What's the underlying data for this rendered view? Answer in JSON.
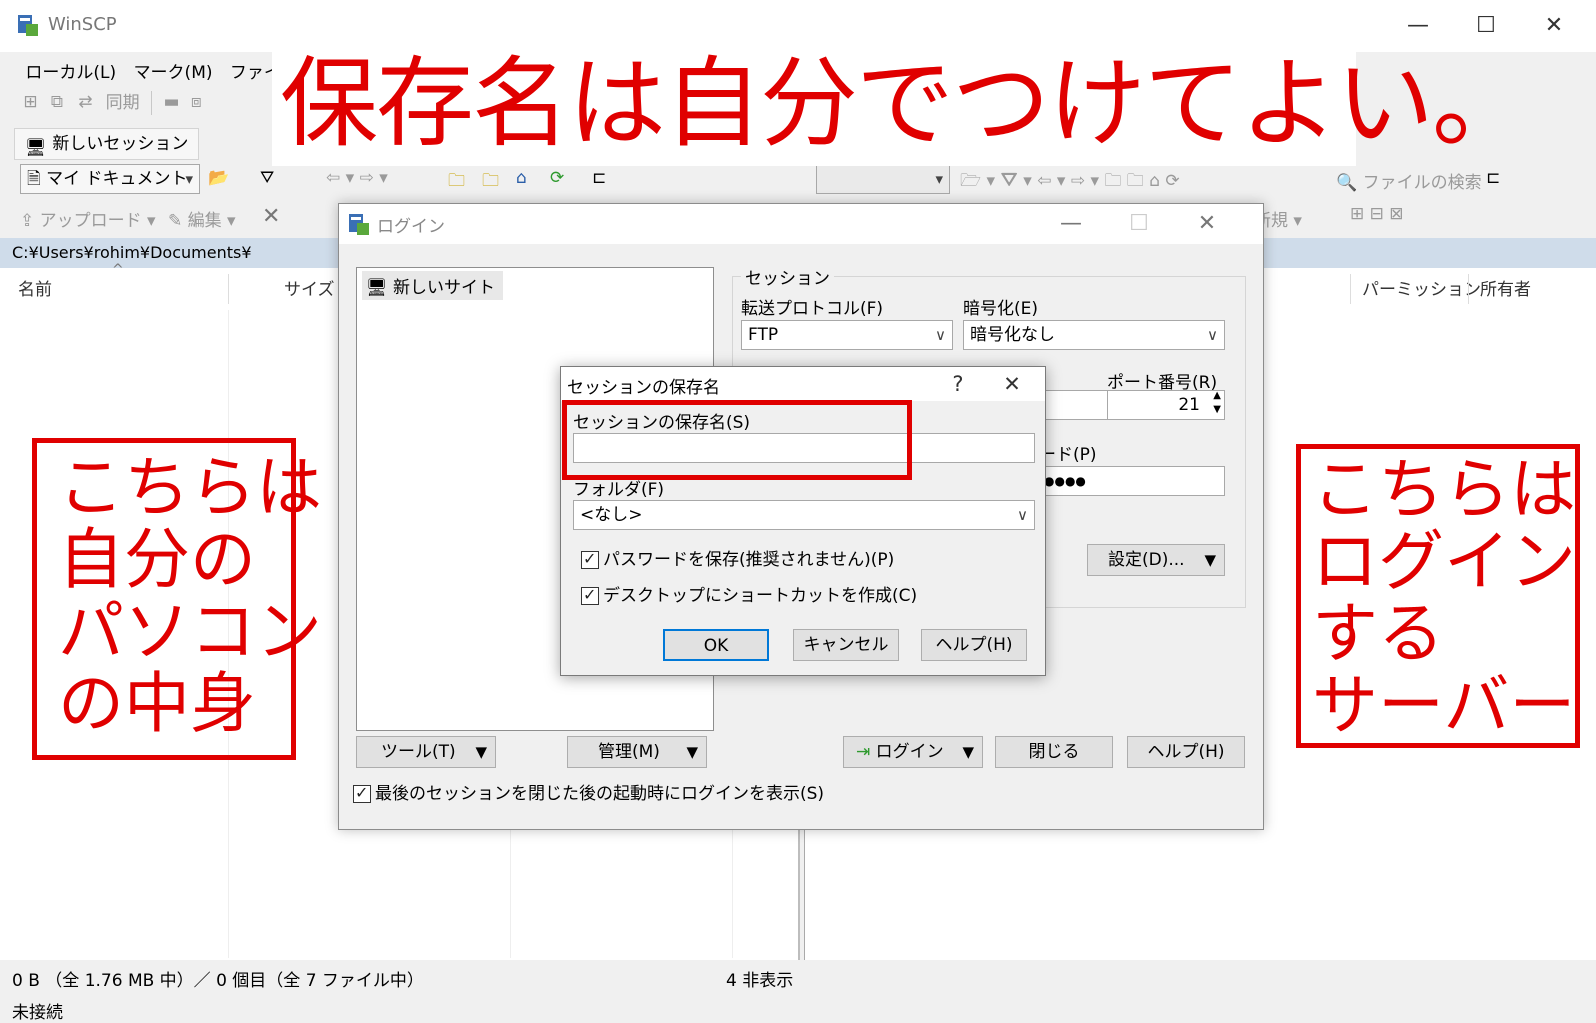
{
  "app": {
    "title": "WinSCP",
    "window_buttons": {
      "minimize": "—",
      "maximize": "☐",
      "close": "✕"
    }
  },
  "menu": [
    "ローカル(L)",
    "マーク(M)",
    "ファイル(F)"
  ],
  "toolbar1": {
    "sync_label": "同期"
  },
  "session_tab": "新しいセッション",
  "toolbar2": {
    "local_path_combo": "マイ ドキュメント",
    "find_files": "ファイルの検索"
  },
  "toolbar3": {
    "upload": "アップロード",
    "edit": "編集",
    "new": "新規"
  },
  "path": "C:¥Users¥rohim¥Documents¥",
  "left_columns": [
    "名前",
    "サイズ"
  ],
  "right_columns": [
    "パーミッション",
    "所有者"
  ],
  "status": {
    "selection": "0 B （全 1.76 MB 中）／ 0 個目（全 7 ファイル中）",
    "hidden": "4 非表示",
    "connection": "未接続"
  },
  "caption": "保存名は自分でつけてよい。",
  "notes": {
    "left": [
      "こちらは",
      "自分の",
      "パソコン",
      "の中身"
    ],
    "right": [
      "こちらは",
      "ログイン",
      "する",
      "サーバー"
    ]
  },
  "login": {
    "title": "ログイン",
    "site_item": "新しいサイト",
    "session_group": "セッション",
    "protocol_label": "転送プロトコル(F)",
    "protocol_value": "FTP",
    "encryption_label": "暗号化(E)",
    "encryption_value": "暗号化なし",
    "port_label": "ポート番号(R)",
    "port_value": "21",
    "password_label_partial": "ード(P)",
    "password_value": "●●●●",
    "settings_button": "設定(D)...",
    "tools_button": "ツール(T)",
    "manage_button": "管理(M)",
    "login_button": "ログイン",
    "close_button": "閉じる",
    "help_button": "ヘルプ(H)",
    "show_login_checkbox": "最後のセッションを閉じた後の起動時にログインを表示(S)"
  },
  "save_dialog": {
    "title": "セッションの保存名",
    "help_btn": "?",
    "close_btn": "✕",
    "name_label": "セッションの保存名(S)",
    "name_value": "",
    "folder_label": "フォルダ(F)",
    "folder_value": "<なし>",
    "save_password": "パスワードを保存(推奨されません)(P)",
    "desktop_shortcut": "デスクトップにショートカットを作成(C)",
    "ok": "OK",
    "cancel": "キャンセル",
    "help": "ヘルプ(H)"
  },
  "colors": {
    "annotation_red": "#e00000",
    "path_bar": "#cfdcea"
  }
}
